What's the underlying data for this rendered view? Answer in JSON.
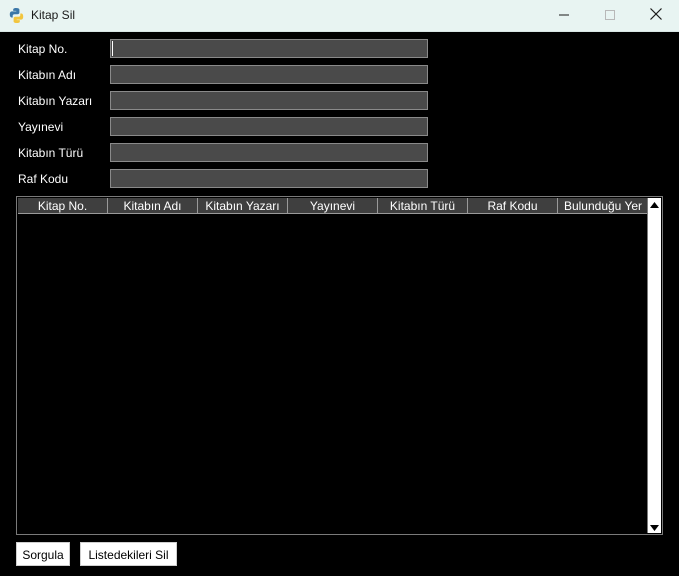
{
  "window": {
    "title": "Kitap Sil",
    "controls": {
      "minimize": "minimize-icon",
      "maximize": "maximize-icon",
      "close": "close-icon"
    }
  },
  "form": {
    "fields": [
      {
        "label": "Kitap No.",
        "value": ""
      },
      {
        "label": "Kitabın Adı",
        "value": ""
      },
      {
        "label": "Kitabın Yazarı",
        "value": ""
      },
      {
        "label": "Yayınevi",
        "value": ""
      },
      {
        "label": "Kitabın Türü",
        "value": ""
      },
      {
        "label": "Raf Kodu",
        "value": ""
      }
    ]
  },
  "table": {
    "columns": [
      "Kitap No.",
      "Kitabın Adı",
      "Kitabın Yazarı",
      "Yayınevi",
      "Kitabın Türü",
      "Raf Kodu",
      "Bulunduğu Yer"
    ],
    "rows": []
  },
  "buttons": {
    "query": "Sorgula",
    "delete_listed": "Listedekileri Sil"
  },
  "colors": {
    "background": "#000000",
    "titlebar": "#e8f4f2",
    "input_bg": "#4a4a4a",
    "header_bg": "#3f3f3f"
  }
}
